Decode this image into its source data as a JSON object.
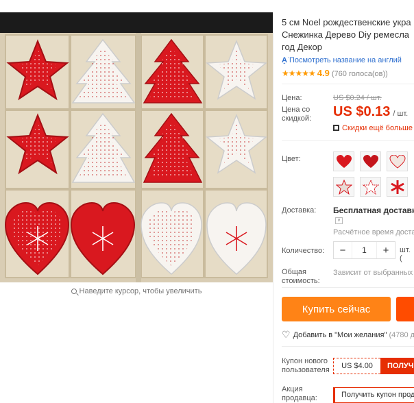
{
  "product": {
    "title_line1": "5 см Noel рождественские укра",
    "title_line2": "Снежинка Дерево Diy ремесла",
    "title_line3": "год Декор",
    "translate_icon": "translate-icon",
    "translate_label": "Посмотреть название на англий",
    "rating_stars": "★★★★★",
    "rating_score": "4.9",
    "votes": "(760 голоса(ов))"
  },
  "image": {
    "zoom_hint": "Наведите курсор, чтобы увеличить"
  },
  "price": {
    "label": "Цена:",
    "old_value": "US $0.24 / шт.",
    "discount_label_line1": "Цена со",
    "discount_label_line2": "скидкой:",
    "new_value": "US $0.13",
    "unit": "/ шт.",
    "promo_text": "Скидки ещё больше"
  },
  "color": {
    "label": "Цвет:",
    "swatch_icons": [
      "heart-red",
      "heart-red",
      "heart-white",
      "star-mixed",
      "star-white",
      "snowflake-red"
    ]
  },
  "shipping": {
    "label": "Доставка:",
    "value": "Бесплатная доставка",
    "delivery_time": "Расчётное время доставк"
  },
  "quantity": {
    "label": "Количество:",
    "minus": "−",
    "value": "1",
    "plus": "+",
    "unit": "шт. ("
  },
  "total": {
    "label_line1": "Общая",
    "label_line2": "стоимость:",
    "value": "Зависит от выбранных"
  },
  "actions": {
    "buy_now": "Купить сейчас",
    "wishlist": "Добавить в \"Мои желания\"",
    "wishlist_count": "(4780 д"
  },
  "coupon": {
    "label_line1": "Купон нового",
    "label_line2": "пользователя",
    "amount": "US $4.00",
    "get": "ПОЛУЧ"
  },
  "seller_promo": {
    "label_line1": "Акция",
    "label_line2": "продавца:",
    "button": "Получить купон прод"
  },
  "colors": {
    "accent_red": "#e62e04",
    "buy_orange": "#ff8316",
    "star_orange": "#ff9900",
    "link_blue": "#2e6fcf"
  }
}
